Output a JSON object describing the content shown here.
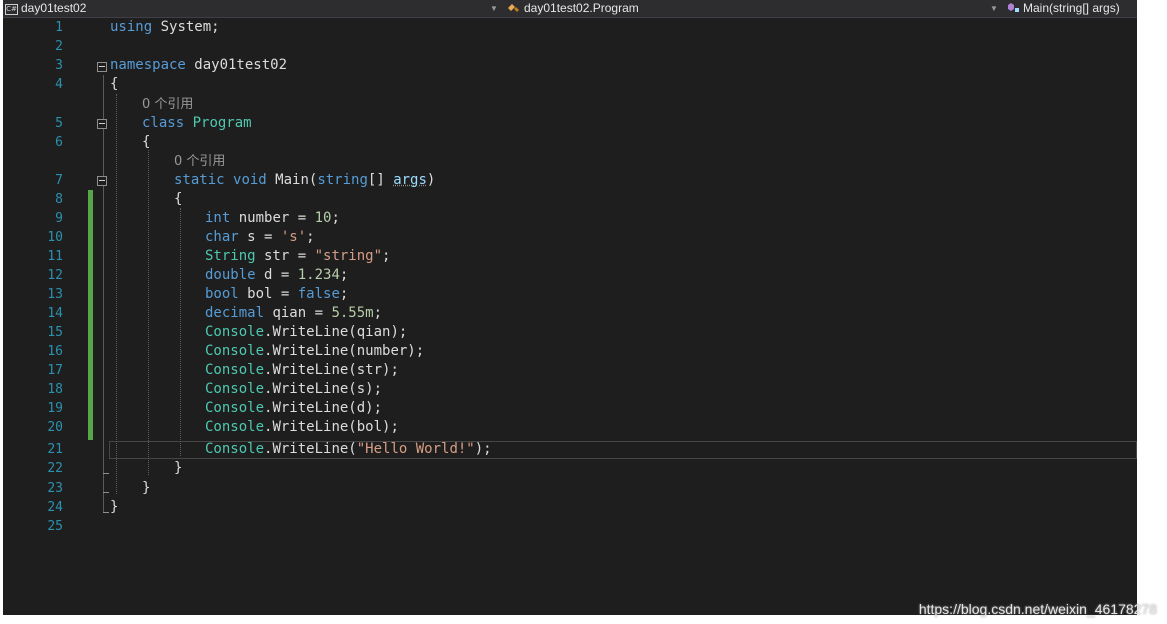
{
  "navbar": {
    "project": "day01test02",
    "class_path": "day01test02.Program",
    "member": "Main(string[] args)",
    "project_icon": "csharp-project-icon",
    "class_icon": "class-icon",
    "member_icon": "method-icon"
  },
  "code_lens": {
    "program_refs": "0 个引用",
    "main_refs": "0 个引用"
  },
  "lines": {
    "1": {
      "n": "1",
      "a": "using",
      "b": " System;"
    },
    "2": {
      "n": "2"
    },
    "3": {
      "n": "3",
      "a": "namespace",
      "b": " day01test02"
    },
    "4": {
      "n": "4",
      "t": "{"
    },
    "5": {
      "n": "5",
      "a": "class",
      "b": "Program"
    },
    "6": {
      "n": "6",
      "t": "{"
    },
    "7": {
      "n": "7",
      "a": "static",
      "b": "void",
      "c": "Main(",
      "d": "string",
      "e": "[] ",
      "f": "args",
      ")": ")"
    },
    "8": {
      "n": "8",
      "t": "{"
    },
    "9": {
      "n": "9",
      "kw": "int",
      "rest": " number = ",
      "v": "10",
      ";": ";"
    },
    "10": {
      "n": "10",
      "kw": "char",
      "rest": " s = ",
      "v": "'s'",
      ";": ";"
    },
    "11": {
      "n": "11",
      "kw": "String",
      "rest": " str = ",
      "v": "\"string\"",
      ";": ";"
    },
    "12": {
      "n": "12",
      "kw": "double",
      "rest": " d = ",
      "v": "1.234",
      ";": ";"
    },
    "13": {
      "n": "13",
      "kw": "bool",
      "rest": " bol = ",
      "v": "false",
      ";": ";"
    },
    "14": {
      "n": "14",
      "kw": "decimal",
      "rest": " qian = ",
      "v": "5.55m",
      ";": ";"
    },
    "15": {
      "n": "15",
      "cls": "Console",
      "rest": ".WriteLine(qian);"
    },
    "16": {
      "n": "16",
      "cls": "Console",
      "rest": ".WriteLine(number);"
    },
    "17": {
      "n": "17",
      "cls": "Console",
      "rest": ".WriteLine(str);"
    },
    "18": {
      "n": "18",
      "cls": "Console",
      "rest": ".WriteLine(s);"
    },
    "19": {
      "n": "19",
      "cls": "Console",
      "rest": ".WriteLine(d);"
    },
    "20": {
      "n": "20",
      "cls": "Console",
      "rest": ".WriteLine(bol);"
    },
    "21": {
      "n": "21",
      "cls": "Console",
      "rest": ".WriteLine(",
      "v": "\"Hello World!\"",
      "end": ");"
    },
    "22": {
      "n": "22",
      "t": "}"
    },
    "23": {
      "n": "23",
      "t": "}"
    },
    "24": {
      "n": "24",
      "t": "}"
    },
    "25": {
      "n": "25"
    }
  },
  "watermark": "https://blog.csdn.net/weixin_46178278",
  "colors": {
    "background": "#1e1e1e",
    "keyword": "#569cd6",
    "type": "#4ec9b0",
    "string": "#d69d85",
    "number": "#b5cea8",
    "line_number": "#2b91af",
    "change_bar": "#57a64a"
  }
}
